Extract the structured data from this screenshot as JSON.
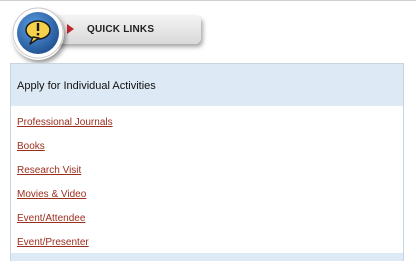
{
  "quick_links": {
    "label": "QUICK LINKS",
    "icon": "speech-bubble-exclamation-icon",
    "accent_color": "#c0262d",
    "badge_color": "#2f6fb5"
  },
  "panel": {
    "title": "Apply for Individual Activities",
    "header_bg": "#dde9f4",
    "link_color": "#9b2f1f",
    "links": [
      "Professional Journals",
      "Books",
      "Research Visit",
      "Movies & Video",
      "Event/Attendee",
      "Event/Presenter"
    ]
  }
}
